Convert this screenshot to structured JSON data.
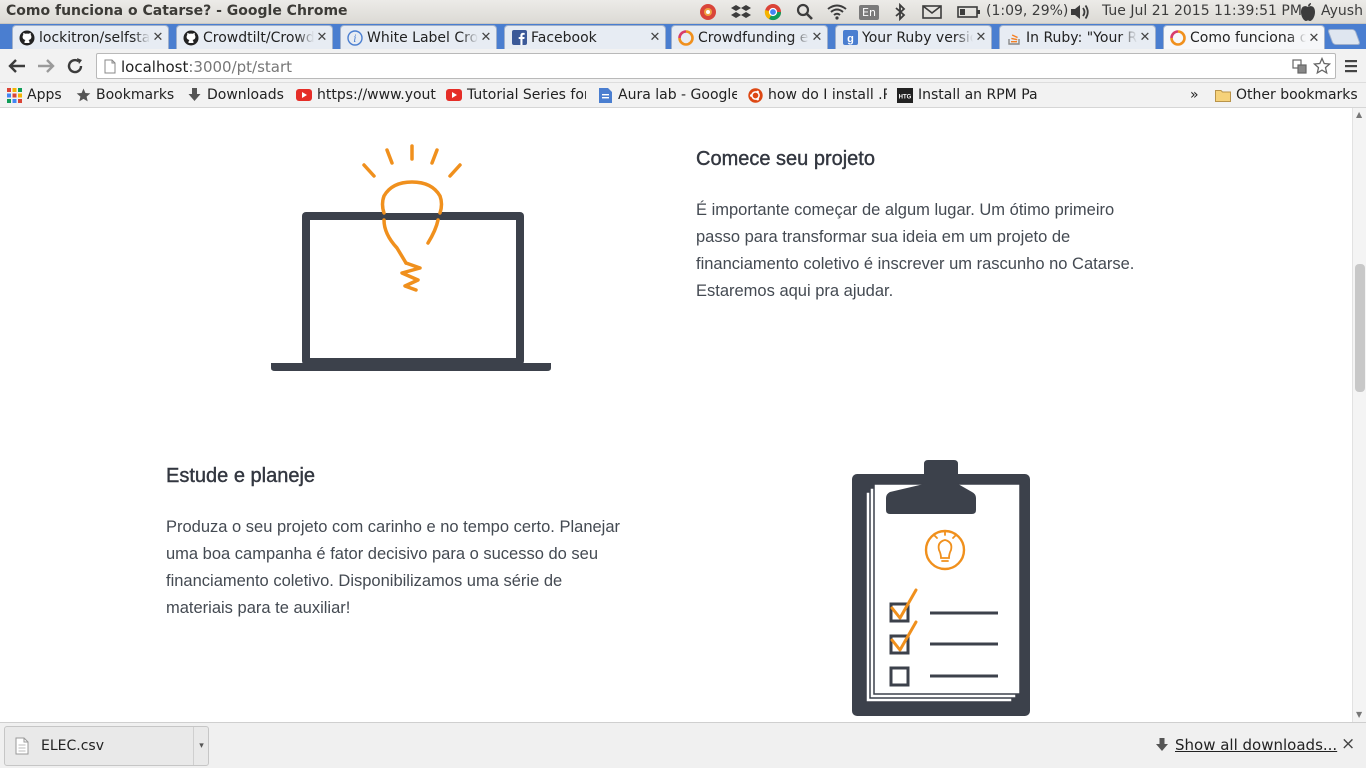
{
  "window": {
    "title": "Como funciona o Catarse? - Google Chrome",
    "tray": {
      "language": "En",
      "battery": "(1:09, 29%)",
      "datetime": "Tue Jul 21 2015 11:39:51 PM",
      "user": "Ayush"
    }
  },
  "tabs": [
    {
      "label": "lockitron/selfstarter",
      "icon": "github-icon"
    },
    {
      "label": "Crowdtilt/CrowdtiltOpen",
      "icon": "github-icon"
    },
    {
      "label": "White Label Crowdfunding",
      "icon": "info-icon"
    },
    {
      "label": "Facebook",
      "icon": "facebook-icon"
    },
    {
      "label": "Crowdfunding e",
      "icon": "catarse-icon"
    },
    {
      "label": "Your Ruby version",
      "icon": "google-icon"
    },
    {
      "label": "In Ruby: \"Your Ruby",
      "icon": "stackoverflow-icon"
    },
    {
      "label": "Como funciona o Catarse?",
      "icon": "catarse-icon",
      "active": true
    }
  ],
  "address": {
    "host": "localhost",
    "path": ":3000/pt/start"
  },
  "bookmarks": {
    "apps": "Apps",
    "items": [
      {
        "label": "Bookmarks",
        "icon": "star-icon"
      },
      {
        "label": "Downloads",
        "icon": "download-icon"
      },
      {
        "label": "https://www.youtube",
        "icon": "youtube-icon"
      },
      {
        "label": "Tutorial Series for",
        "icon": "youtube-icon"
      },
      {
        "label": "Aura lab - Google",
        "icon": "google-docs-icon"
      },
      {
        "label": "how do I install .RPM",
        "icon": "ubuntu-icon"
      },
      {
        "label": "Install an RPM Package",
        "icon": "htg-icon"
      }
    ],
    "overflow": "»",
    "other": "Other bookmarks"
  },
  "sections": [
    {
      "title": "Comece seu projeto",
      "lines": [
        "É importante começar de algum lugar. Um ótimo primeiro",
        "passo para transformar sua ideia em um projeto de",
        "financiamento coletivo é inscrever um rascunho no Catarse.",
        "Estaremos aqui pra ajudar."
      ]
    },
    {
      "title": "Estude e planeje",
      "lines": [
        "Produza o seu projeto com carinho e no tempo certo. Planejar",
        "uma boa campanha é fator decisivo para o sucesso do seu",
        "financiamento coletivo. Disponibilizamos uma série de",
        "materiais para te auxiliar!"
      ]
    }
  ],
  "downloads": {
    "file": "ELEC.csv",
    "show_all": "Show all downloads...",
    "close": "×"
  },
  "colors": {
    "accent_orange": "#f0901d",
    "illustration_dark": "#3c414b",
    "tab_strip": "#4a7ed0"
  }
}
